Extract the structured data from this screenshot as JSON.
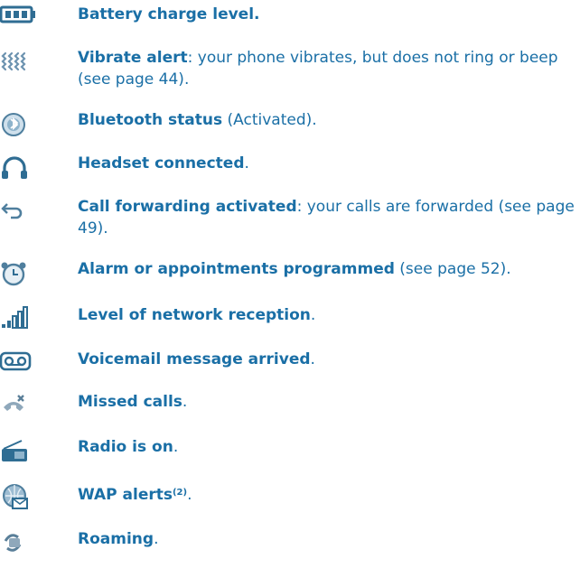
{
  "items": [
    {
      "icon": "battery-icon",
      "title": "Battery charge level.",
      "desc": ""
    },
    {
      "icon": "vibrate-icon",
      "title": "Vibrate alert",
      "desc": ": your phone vibrates, but does not ring or beep (see page 44)."
    },
    {
      "icon": "bluetooth-icon",
      "title": "Bluetooth status",
      "desc": " (Activated)."
    },
    {
      "icon": "headset-icon",
      "title": "Headset connected",
      "desc": "."
    },
    {
      "icon": "call-forward-icon",
      "title": "Call forwarding activated",
      "desc": ": your calls are forwarded (see page 49)."
    },
    {
      "icon": "alarm-clock-icon",
      "title": "Alarm or appointments programmed",
      "desc": " (see page 52)."
    },
    {
      "icon": "signal-strength-icon",
      "title": "Level of network reception",
      "desc": "."
    },
    {
      "icon": "voicemail-icon",
      "title": "Voicemail message arrived",
      "desc": "."
    },
    {
      "icon": "missed-call-icon",
      "title": "Missed calls",
      "desc": "."
    },
    {
      "icon": "radio-icon",
      "title": "Radio is on",
      "desc": "."
    },
    {
      "icon": "wap-alert-icon",
      "title": "WAP alerts",
      "note": "(2)",
      "desc": "."
    },
    {
      "icon": "roaming-icon",
      "title": "Roaming",
      "desc": "."
    }
  ],
  "colors": {
    "text": "#1a6fa6",
    "icon": "#2f6d93",
    "icon_light": "#8fb4cc"
  }
}
